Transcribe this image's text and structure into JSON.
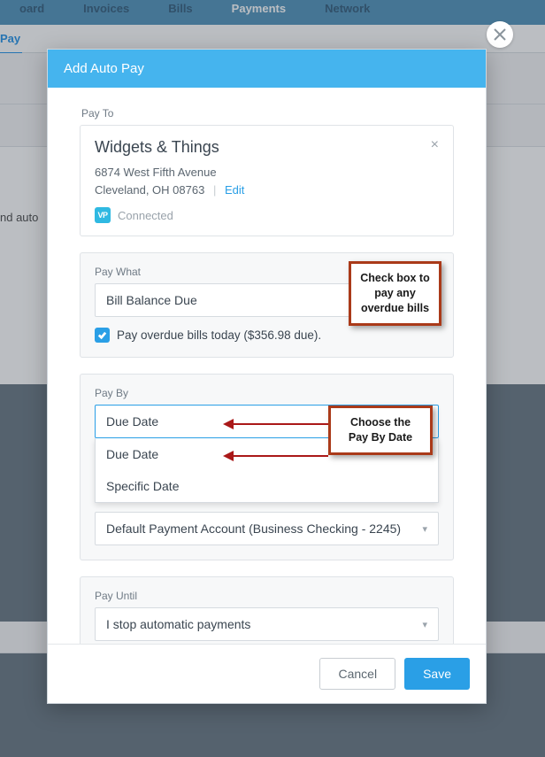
{
  "nav": {
    "tabs": [
      "oard",
      "Invoices",
      "Bills",
      "Payments",
      "Network"
    ],
    "active_index": 3,
    "subtab": "Pay"
  },
  "bg_partial_text": "nd auto",
  "modal": {
    "title": "Add Auto Pay",
    "pay_to": {
      "label": "Pay To",
      "vendor": "Widgets & Things",
      "address_line1": "6874 West Fifth Avenue",
      "address_line2": "Cleveland, OH 08763",
      "edit": "Edit",
      "badge": "VP",
      "connected": "Connected"
    },
    "pay_what": {
      "label": "Pay What",
      "value": "Bill Balance Due",
      "checkbox_label": "Pay overdue bills today ($356.98 due).",
      "checkbox_checked": true
    },
    "pay_by": {
      "label": "Pay By",
      "selected": "Due Date",
      "options": [
        "Due Date",
        "Specific Date"
      ]
    },
    "pay_from": {
      "value": "Default Payment Account (Business Checking - 2245)"
    },
    "pay_until": {
      "label": "Pay Until",
      "value": "I stop automatic payments"
    },
    "buttons": {
      "cancel": "Cancel",
      "save": "Save"
    }
  },
  "callouts": {
    "overdue": "Check box to pay any overdue bills",
    "payby": "Choose the Pay By Date"
  }
}
